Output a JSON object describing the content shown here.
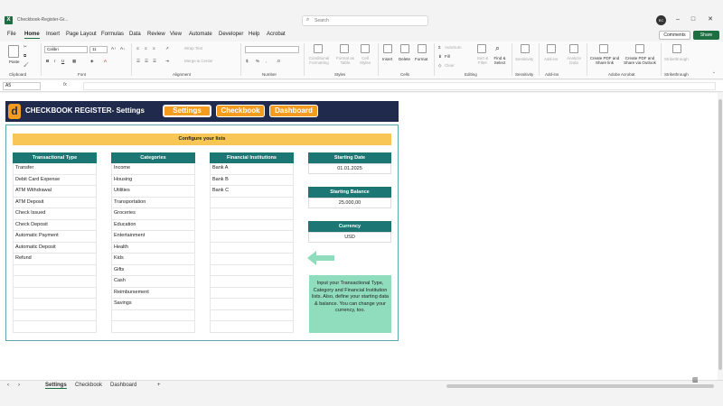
{
  "window": {
    "title": "Checkbook-Register-Gr...",
    "search_placeholder": "Search",
    "avatar_initials": "EC"
  },
  "menu": {
    "items": [
      "File",
      "Home",
      "Insert",
      "Page Layout",
      "Formulas",
      "Data",
      "Review",
      "View",
      "Automate",
      "Developer",
      "Help",
      "Acrobat"
    ],
    "active": "Home",
    "comments": "Comments",
    "share": "Share"
  },
  "ribbon": {
    "font_name": "Calibri",
    "font_size": "11",
    "wrap_text": "Wrap Text",
    "merge_center": "Merge & Center",
    "groups": {
      "clipboard": "Clipboard",
      "font": "Font",
      "alignment": "Alignment",
      "number": "Number",
      "styles": "Styles",
      "cells": "Cells",
      "editing": "Editing",
      "sensitivity": "Sensitivity",
      "addins": "Add-ins",
      "adobe": "Adobe Acrobat",
      "strikethrough": "Strikethrough"
    },
    "labels": {
      "paste": "Paste",
      "conditional": "Conditional Formatting",
      "format_table": "Format as Table",
      "cell_styles": "Cell Styles",
      "insert": "Insert",
      "delete": "Delete",
      "format": "Format",
      "autosum": "AutoSum",
      "fill": "Fill",
      "clear": "Clear",
      "sort": "Sort & Filter",
      "find": "Find & Select",
      "sensitivity": "Sensitivity",
      "addins": "Add-ins",
      "analyze": "Analyze Data",
      "create_pdf_link": "Create PDF and Share link",
      "create_pdf_outlook": "Create PDF and Share via Outlook",
      "strikethrough": "Strikethrough"
    }
  },
  "formula_bar": {
    "name_box": "A5",
    "fx": "fx",
    "value": ""
  },
  "app": {
    "title": "CHECKBOOK REGISTER- Settings",
    "logo_letter": "d",
    "nav": [
      "Settings",
      "Checkbook",
      "Dashboard"
    ],
    "nav_active": "Settings",
    "banner": "Configure your lists"
  },
  "lists": {
    "transactional_type": {
      "header": "Transactional Type",
      "items": [
        "Transfer",
        "Debit Card Expense",
        "ATM Withdrawal",
        "ATM Deposit",
        "Check Issued",
        "Check Deposit",
        "Automatic Payment",
        "Automatic Deposit",
        "Refund",
        "",
        "",
        "",
        "",
        "",
        ""
      ]
    },
    "categories": {
      "header": "Categories",
      "items": [
        "Income",
        "Housing",
        "Utilities",
        "Transportation",
        "Groceries",
        "Education",
        "Entertainment",
        "Health",
        "Kids",
        "Gifts",
        "Cash",
        "Reimbursement",
        "Savings",
        "",
        ""
      ]
    },
    "institutions": {
      "header": "Financial Institutions",
      "items": [
        "Bank A",
        "Bank B",
        "Bank C",
        "",
        "",
        "",
        "",
        "",
        "",
        "",
        "",
        "",
        "",
        "",
        ""
      ]
    }
  },
  "settings": {
    "starting_date_label": "Starting Date",
    "starting_date": "01.01.2025",
    "starting_balance_label": "Starting Balance",
    "starting_balance": "25.000,00",
    "currency_label": "Currency",
    "currency": "USD"
  },
  "note": "Input your Transactional Type, Category and Financial Institution lists. Also, define your starting data & balance. You can change your currency, too.",
  "sheet_tabs": [
    "Settings",
    "Checkbook",
    "Dashboard"
  ],
  "sheet_tab_active": "Settings",
  "colors": {
    "navy": "#1f2a4d",
    "orange": "#f39c1f",
    "teal": "#1b7674",
    "banner_yellow": "#f7c655",
    "note_green": "#8fddbd",
    "excel_green": "#1d6f42"
  }
}
